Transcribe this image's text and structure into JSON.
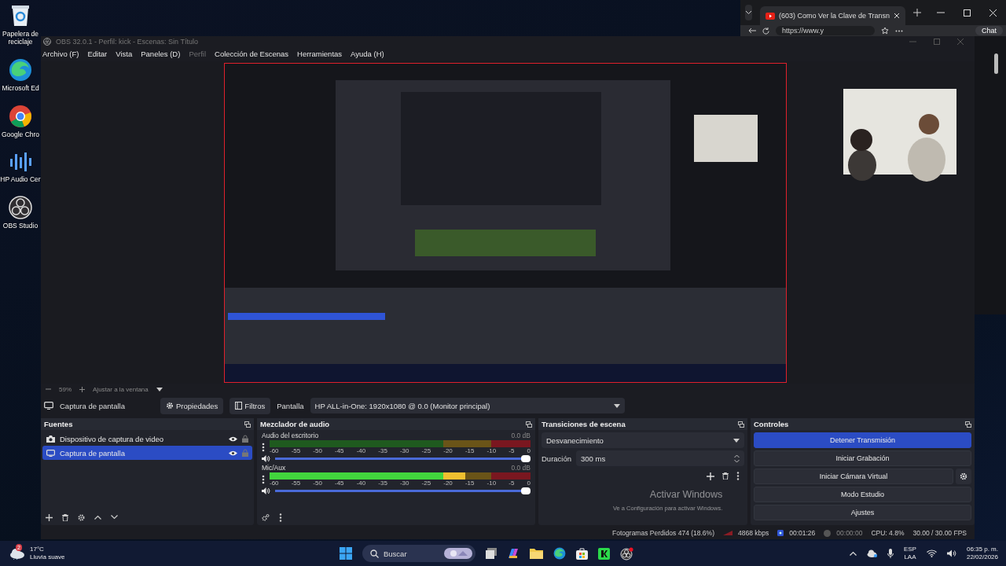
{
  "desktop_icons": [
    {
      "label": "Papelera de reciclaje",
      "kind": "recycle"
    },
    {
      "label": "Microsoft Ed",
      "kind": "edge"
    },
    {
      "label": "Google Chro",
      "kind": "chrome"
    },
    {
      "label": "HP Audio Cer",
      "kind": "audio"
    },
    {
      "label": "OBS Studio",
      "kind": "obs"
    }
  ],
  "browser": {
    "tab_title": "(603) Como Ver la Clave de Transn",
    "address": "https://www.y",
    "chat": "Chat"
  },
  "obs": {
    "title": "OBS 32.0.1 - Perfil: kick - Escenas: Sin Título",
    "menu": [
      {
        "label": "Archivo (F)",
        "disabled": false
      },
      {
        "label": "Editar",
        "disabled": false
      },
      {
        "label": "Vista",
        "disabled": false
      },
      {
        "label": "Paneles (D)",
        "disabled": false
      },
      {
        "label": "Perfil",
        "disabled": true
      },
      {
        "label": "Colección de Escenas",
        "disabled": false
      },
      {
        "label": "Herramientas",
        "disabled": false
      },
      {
        "label": "Ayuda (H)",
        "disabled": false
      }
    ],
    "zoom": {
      "value": "59%",
      "fit": "Ajustar a la ventana"
    },
    "source_toolbar": {
      "source": "Captura de pantalla",
      "properties": "Propiedades",
      "filters": "Filtros",
      "display_label": "Pantalla",
      "display_value": "HP ALL-in-One: 1920x1080 @ 0.0 (Monitor principal)"
    },
    "sources": {
      "title": "Fuentes",
      "items": [
        {
          "name": "Dispositivo de captura de video",
          "kind": "camera",
          "selected": false
        },
        {
          "name": "Captura de pantalla",
          "kind": "display",
          "selected": true
        }
      ]
    },
    "mixer": {
      "title": "Mezclador de audio",
      "channels": [
        {
          "name": "Audio del escritorio",
          "reading": "0.0 dB",
          "volume": {
            "level": 1
          },
          "scale": [
            "-60",
            "-55",
            "-50",
            "-45",
            "-40",
            "-35",
            "-30",
            "-25",
            "-20",
            "-15",
            "-10",
            "-5",
            "0"
          ]
        },
        {
          "name": "Mic/Aux",
          "reading": "0.0 dB",
          "level": 0.75,
          "volume": {
            "level": 1
          },
          "scale": [
            "-60",
            "-55",
            "-50",
            "-45",
            "-40",
            "-35",
            "-30",
            "-25",
            "-20",
            "-15",
            "-10",
            "-5",
            "0"
          ]
        }
      ]
    },
    "transitions": {
      "title": "Transiciones de escena",
      "selected": "Desvanecimiento",
      "duration_label": "Duración",
      "duration": "300 ms"
    },
    "controls": {
      "title": "Controles",
      "buttons": [
        {
          "label": "Detener Transmisión",
          "active": true,
          "kind": "plain"
        },
        {
          "label": "Iniciar Grabación",
          "active": false,
          "kind": "plain"
        },
        {
          "label": "Iniciar Cámara Virtual",
          "active": false,
          "kind": "gear"
        },
        {
          "label": "Modo Estudio",
          "active": false,
          "kind": "plain"
        },
        {
          "label": "Ajustes",
          "active": false,
          "kind": "plain"
        }
      ]
    },
    "status": {
      "dropped": "Fotogramas Perdidos 474 (18.6%)",
      "bitrate": "4868 kbps",
      "stream_time": "00:01:26",
      "record_time": "00:00:00",
      "cpu": "CPU: 4.8%",
      "fps": "30.00 / 30.00 FPS"
    }
  },
  "activation": {
    "title": "Activar Windows",
    "text": "Ve a Configuración para activar Windows."
  },
  "taskbar": {
    "temperature": "17°C",
    "weather": "Lluvia suave",
    "weather_badge": "2",
    "search": "Buscar",
    "language": "ESP",
    "layout": "LAA",
    "time": "06:35 p. m.",
    "date": "22/02/2026"
  }
}
